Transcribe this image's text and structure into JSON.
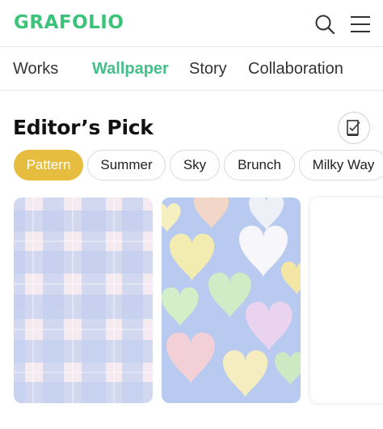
{
  "header": {
    "logo_text": "GRAFOLIO",
    "icons": [
      "search-icon",
      "menu-icon"
    ]
  },
  "tabs": [
    {
      "label": "Works",
      "active": false
    },
    {
      "label": "Wallpaper",
      "active": true
    },
    {
      "label": "Story",
      "active": false
    },
    {
      "label": "Collaboration",
      "active": false
    }
  ],
  "section": {
    "title": "Editor’s Pick",
    "action_icon": "edit-note-icon"
  },
  "chips": [
    {
      "label": "Pattern",
      "selected": true
    },
    {
      "label": "Summer",
      "selected": false
    },
    {
      "label": "Sky",
      "selected": false
    },
    {
      "label": "Brunch",
      "selected": false
    },
    {
      "label": "Milky Way",
      "selected": false
    }
  ],
  "cards": [
    {
      "name": "plaid-pattern-wallpaper"
    },
    {
      "name": "pastel-hearts-wallpaper"
    },
    {
      "name": "next-wallpaper-card"
    }
  ],
  "colors": {
    "brand_green": "#3dc27a",
    "active_tab": "#45c08a",
    "chip_selected": "#e6bd3e",
    "divider": "#e6e6e6"
  }
}
